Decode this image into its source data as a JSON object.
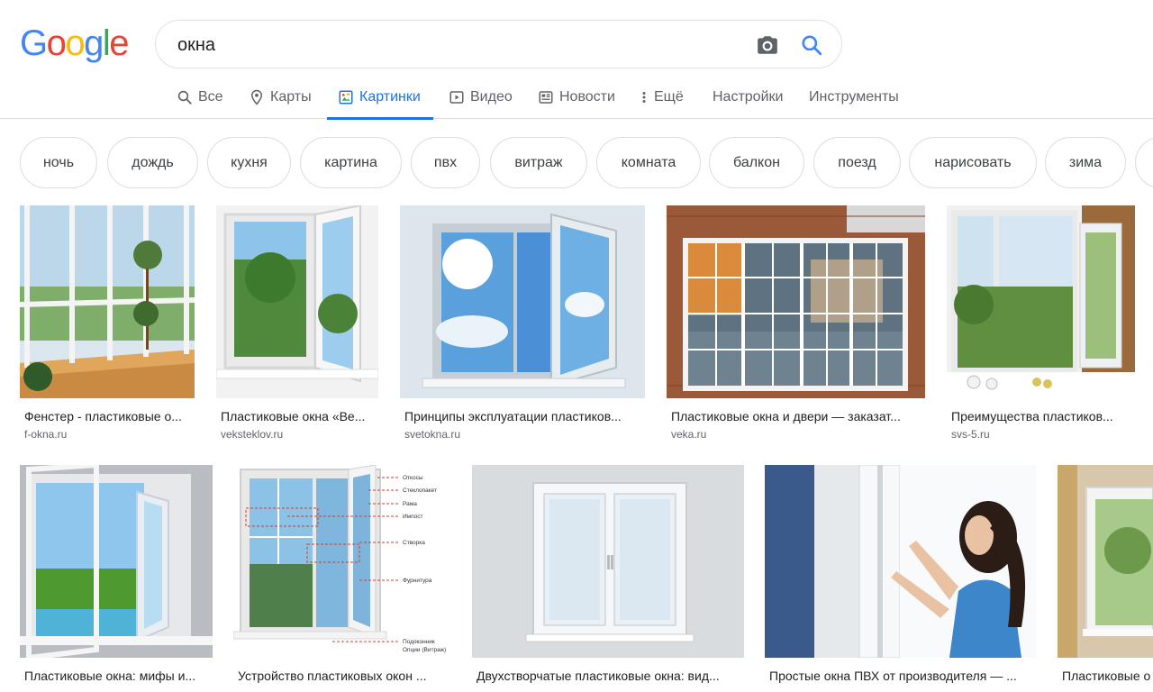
{
  "logo": {
    "letters": [
      "G",
      "o",
      "o",
      "g",
      "l",
      "e"
    ]
  },
  "search": {
    "query": "окна",
    "placeholder": ""
  },
  "tabs": [
    {
      "label": "Все",
      "icon": "search-icon"
    },
    {
      "label": "Карты",
      "icon": "map-pin-icon"
    },
    {
      "label": "Картинки",
      "icon": "image-icon",
      "active": true
    },
    {
      "label": "Видео",
      "icon": "video-icon"
    },
    {
      "label": "Новости",
      "icon": "news-icon"
    },
    {
      "label": "Ещё",
      "icon": "more-icon"
    },
    {
      "label": "Настройки"
    },
    {
      "label": "Инструменты"
    }
  ],
  "chips": [
    "ночь",
    "дождь",
    "кухня",
    "картина",
    "пвх",
    "витраж",
    "комната",
    "балкон",
    "поезд",
    "нарисовать",
    "зима"
  ],
  "results_row1": [
    {
      "title": "Фенстер - пластиковые о...",
      "site": "f-okna.ru"
    },
    {
      "title": "Пластиковые окна «Ве...",
      "site": "veksteklov.ru"
    },
    {
      "title": "Принципы эксплуатации пластиков...",
      "site": "svetokna.ru"
    },
    {
      "title": "Пластиковые окна и двери — заказат...",
      "site": "veka.ru"
    },
    {
      "title": "Преимущества пластиков...",
      "site": "svs-5.ru"
    }
  ],
  "results_row2": [
    {
      "title": "Пластиковые окна: мифы и...",
      "site": ""
    },
    {
      "title": "Устройство пластиковых окон ...",
      "site": ""
    },
    {
      "title": "Двухстворчатые пластиковые окна: вид...",
      "site": ""
    },
    {
      "title": "Простые окна ПВХ от производителя — ...",
      "site": ""
    },
    {
      "title": "Пластиковые о",
      "site": ""
    }
  ],
  "diagram_labels": [
    "Откосы",
    "Стеклопакет",
    "Рама",
    "Импост",
    "Створка",
    "Фурнитура",
    "Подоконник",
    "Опции (Витраж)"
  ],
  "colors": {
    "accent": "#1a73e8",
    "chip_border": "#dadce0",
    "muted": "#5f6368"
  }
}
